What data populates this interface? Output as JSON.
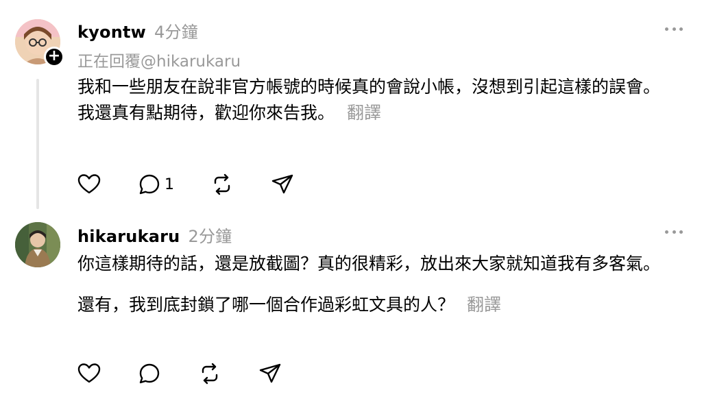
{
  "posts": [
    {
      "username": "kyontw",
      "time": "4分鐘",
      "reply_to": "正在回覆@hikarukaru",
      "paragraphs": [
        "我和一些朋友在說非官方帳號的時候真的會說小帳，沒想到引起這樣的誤會。",
        "我還真有點期待，歡迎你來告我。"
      ],
      "translate_label": "翻譯",
      "reply_count": "1",
      "icons": [
        "heart-icon",
        "comment-icon",
        "repost-icon",
        "share-icon",
        "more-icon",
        "follow-plus-icon"
      ]
    },
    {
      "username": "hikarukaru",
      "time": "2分鐘",
      "paragraphs": [
        "你這樣期待的話，還是放截圖？真的很精彩，放出來大家就知道我有多客氣。",
        "還有，我到底封鎖了哪一個合作過彩虹文具的人？"
      ],
      "translate_label": "翻譯",
      "icons": [
        "heart-icon",
        "comment-icon",
        "repost-icon",
        "share-icon",
        "more-icon"
      ]
    }
  ]
}
